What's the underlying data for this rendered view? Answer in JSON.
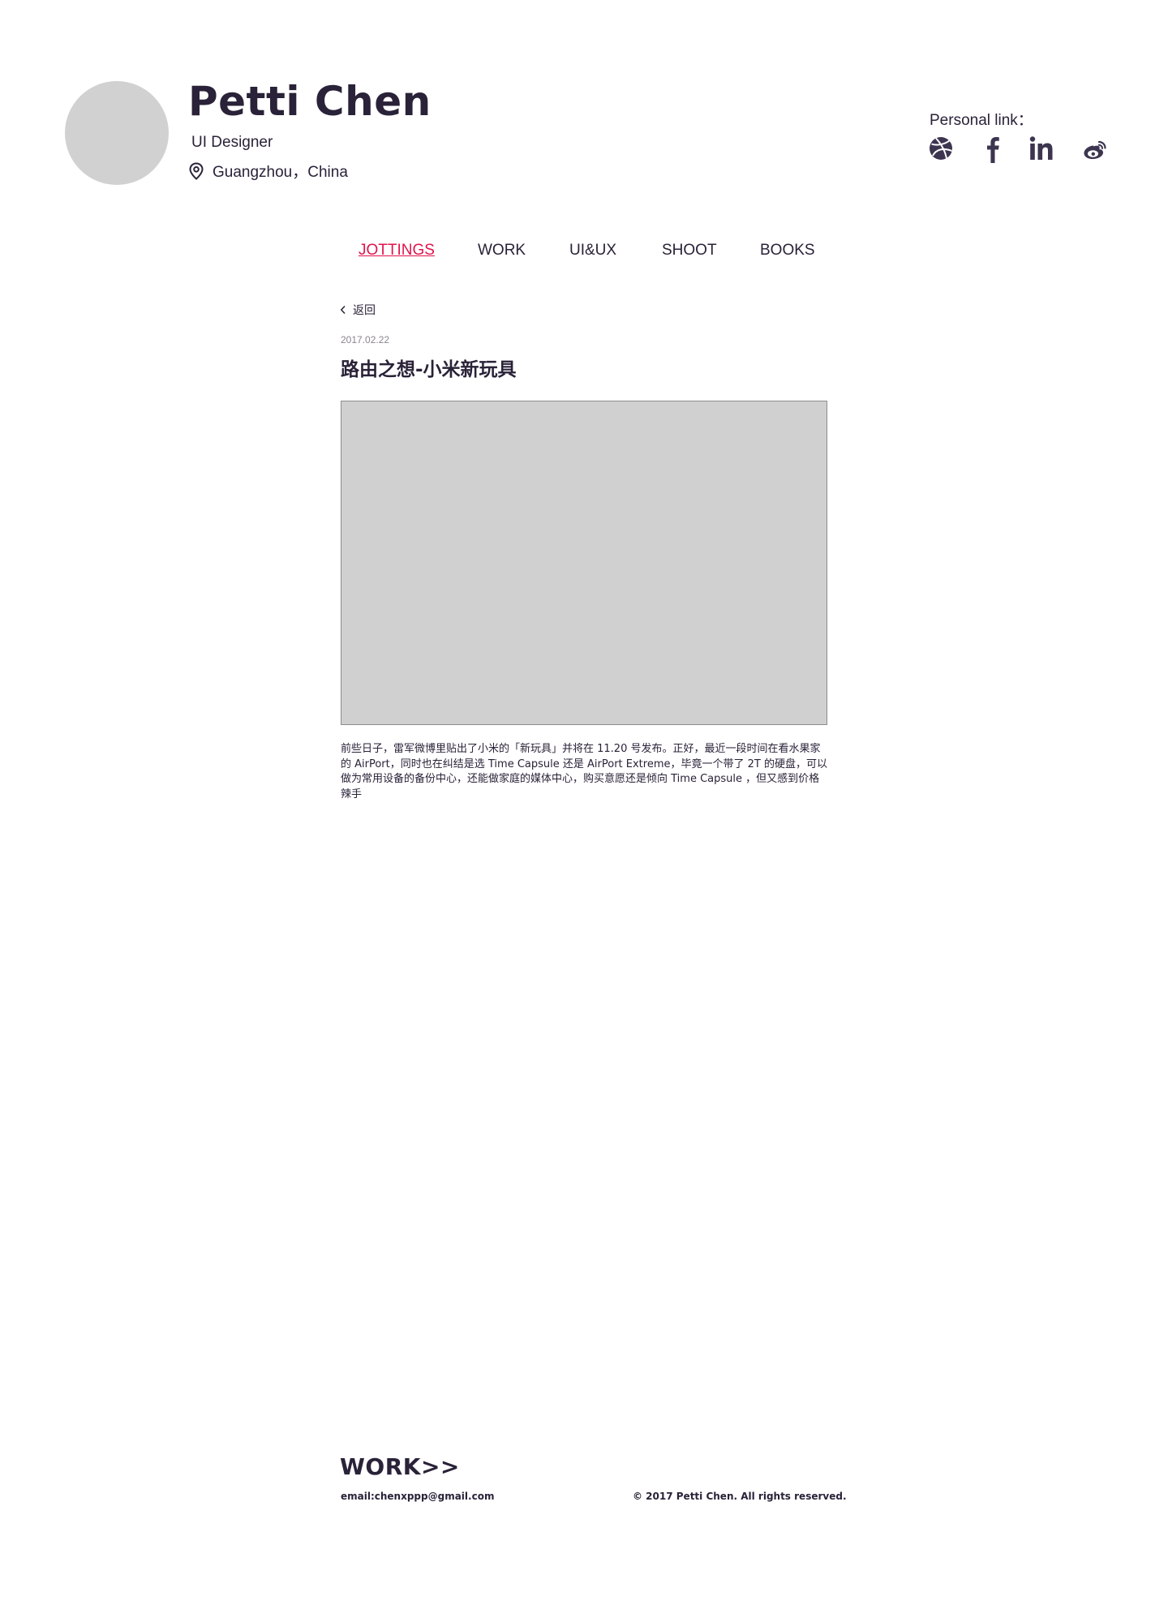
{
  "profile": {
    "name": "Petti Chen",
    "title": "UI Designer",
    "location": "Guangzhou，China",
    "location_icon": "location-pin-icon"
  },
  "personal_links": {
    "label": "Personal link：",
    "icons": [
      "dribbble-icon",
      "facebook-icon",
      "linkedin-icon",
      "weibo-icon"
    ]
  },
  "nav": {
    "tabs": [
      {
        "label": "JOTTINGS",
        "active": true
      },
      {
        "label": "WORK",
        "active": false
      },
      {
        "label": "UI&UX",
        "active": false
      },
      {
        "label": "SHOOT",
        "active": false
      },
      {
        "label": "BOOKS",
        "active": false
      }
    ],
    "active_color": "#e0144c"
  },
  "post": {
    "back_label": "返回",
    "date": "2017.02.22",
    "title": "路由之想-小米新玩具",
    "body": "前些日子，雷军微博里贴出了小米的「新玩具」并将在 11.20 号发布。正好，最近一段时间在看水果家的 AirPort，同时也在纠结是选 Time Capsule 还是 AirPort Extreme，毕竟一个带了 2T 的硬盘，可以做为常用设备的备份中心，还能做家庭的媒体中心，购买意愿还是倾向 Time Capsule ，但又感到价格辣手"
  },
  "footer": {
    "work_link": "WORK>>",
    "email": "email:chenxppp@gmail.com",
    "copyright": "© 2017 Petti Chen. All rights reserved."
  },
  "colors": {
    "text": "#2a2238",
    "avatar_placeholder": "#d1d1d1",
    "image_placeholder": "#d0d0d0",
    "accent": "#e0144c"
  }
}
